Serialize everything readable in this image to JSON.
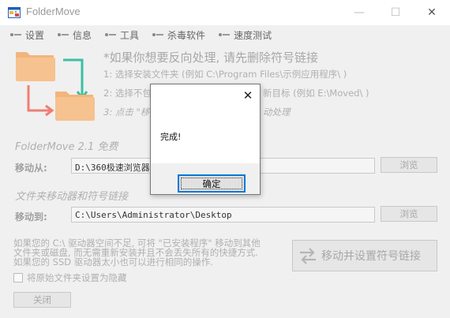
{
  "window": {
    "title": "FolderMove",
    "controls": {
      "minimize": "—",
      "maximize": "☐",
      "close": "✕"
    }
  },
  "menu": [
    {
      "label": "设置"
    },
    {
      "label": "信息"
    },
    {
      "label": "工具"
    },
    {
      "label": "杀毒软件"
    },
    {
      "label": "速度测试"
    }
  ],
  "instructions": {
    "headline": "*如果你想要反向处理, 请先删除符号链接",
    "step1": "1: 选择安装文件夹 (例如 C:\\Program Files\\示例应用程序\\ )",
    "step2_start": "2: 选择不包",
    "step2_end": "新目标 (例如 E:\\Moved\\ )",
    "step3_start": "3: 点击 \"移",
    "step3_end": "动处理"
  },
  "version_title": "FolderMove 2.1 免费",
  "section_subtitle": "文件夹移动器和符号链接",
  "source": {
    "label": "移动从:",
    "value": "D:\\360极速浏览器",
    "browse": "浏览"
  },
  "destination": {
    "label": "移动到:",
    "value": "C:\\Users\\Administrator\\Desktop",
    "browse": "浏览"
  },
  "info": {
    "line1": "如果您的 C:\\ 驱动器空间不足, 可将 \"已安装程序\" 移动到其他",
    "line2": "文件夹或磁盘, 而无需重新安装并且不会丢失所有的快捷方式.",
    "line3": "如果您的 SSD 驱动器太小也可以进行相同的操作."
  },
  "hide_checkbox_label": "将原始文件夹设置为隐藏",
  "move_button": "移动并设置符号链接",
  "close_button": "关闭",
  "dialog": {
    "message": "完成!",
    "ok": "确定",
    "close_glyph": "✕"
  },
  "colors": {
    "folder": "#f6c28f",
    "arrow_teal": "#3bbfa3",
    "arrow_red": "#ef7e74",
    "focus_blue": "#0078d7"
  }
}
